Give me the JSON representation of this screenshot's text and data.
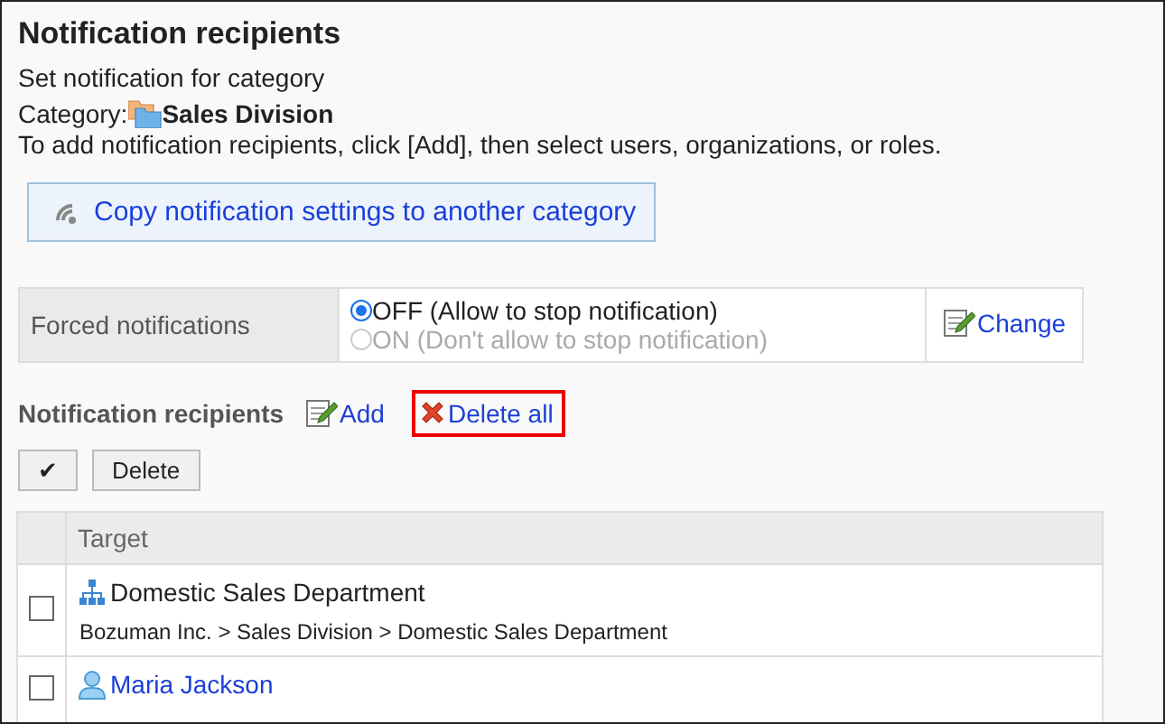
{
  "title": "Notification recipients",
  "subtitle": "Set notification for category",
  "category": {
    "label": "Category:",
    "name": "Sales Division"
  },
  "instructions": "To add notification recipients, click [Add], then select users, organizations, or roles.",
  "copy_button": "Copy notification settings to another category",
  "forced_notifications": {
    "label": "Forced notifications",
    "options": [
      {
        "label": "OFF (Allow to stop notification)",
        "selected": true,
        "disabled": false
      },
      {
        "label": "ON (Don't allow to stop notification)",
        "selected": false,
        "disabled": true
      }
    ],
    "change": "Change"
  },
  "recipients_heading": "Notification recipients",
  "actions": [
    {
      "label": "Add",
      "kind": "add",
      "highlighted": false
    },
    {
      "label": "Delete all",
      "kind": "delete",
      "highlighted": true
    }
  ],
  "check_all": "✔",
  "delete_button": "Delete",
  "table": {
    "columns": [
      "Target"
    ],
    "rows": [
      {
        "kind": "organization",
        "name": "Domestic Sales Department",
        "path": "Bozuman Inc. > Sales Division > Domestic Sales Department",
        "checked": false
      },
      {
        "kind": "user",
        "name": "Maria Jackson",
        "checked": false
      }
    ]
  }
}
